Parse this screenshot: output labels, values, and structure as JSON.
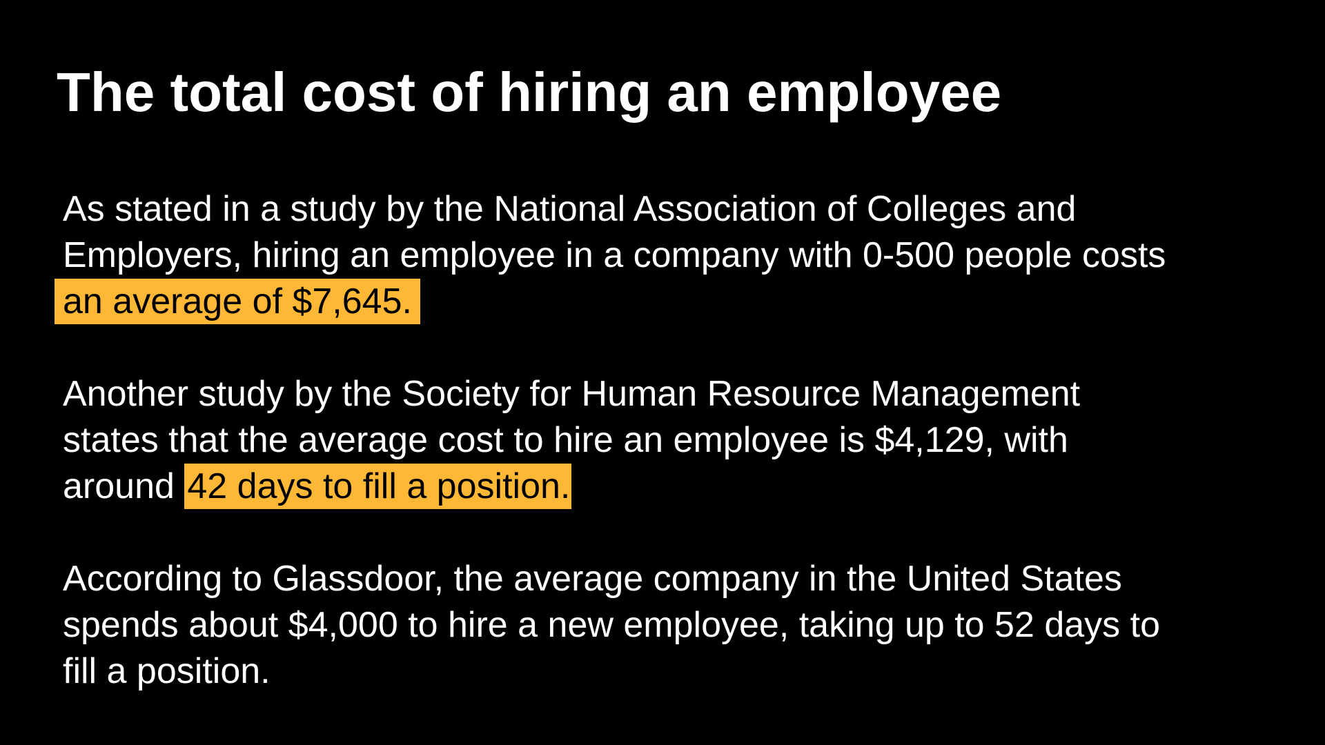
{
  "slide": {
    "title": "The total cost of hiring an employee",
    "highlight_color": "#ffb835",
    "background_color": "#000000",
    "paragraphs": [
      {
        "line1": "As stated in a study by the National Association of Colleges and",
        "line2": "Employers, hiring an employee in a company with 0-500 people costs",
        "line3_highlight": "an average of $7,645."
      },
      {
        "line1": "Another study by the Society for Human Resource Management",
        "line2": "states that the average cost to hire an employee is $4,129, with",
        "line3_prefix": "around ",
        "line3_highlight": "42 days to fill a position."
      },
      {
        "line1": "According to Glassdoor, the average company in the United States",
        "line2": "spends about $4,000 to hire a new employee, taking up to 52 days to",
        "line3": "fill a position."
      }
    ]
  }
}
